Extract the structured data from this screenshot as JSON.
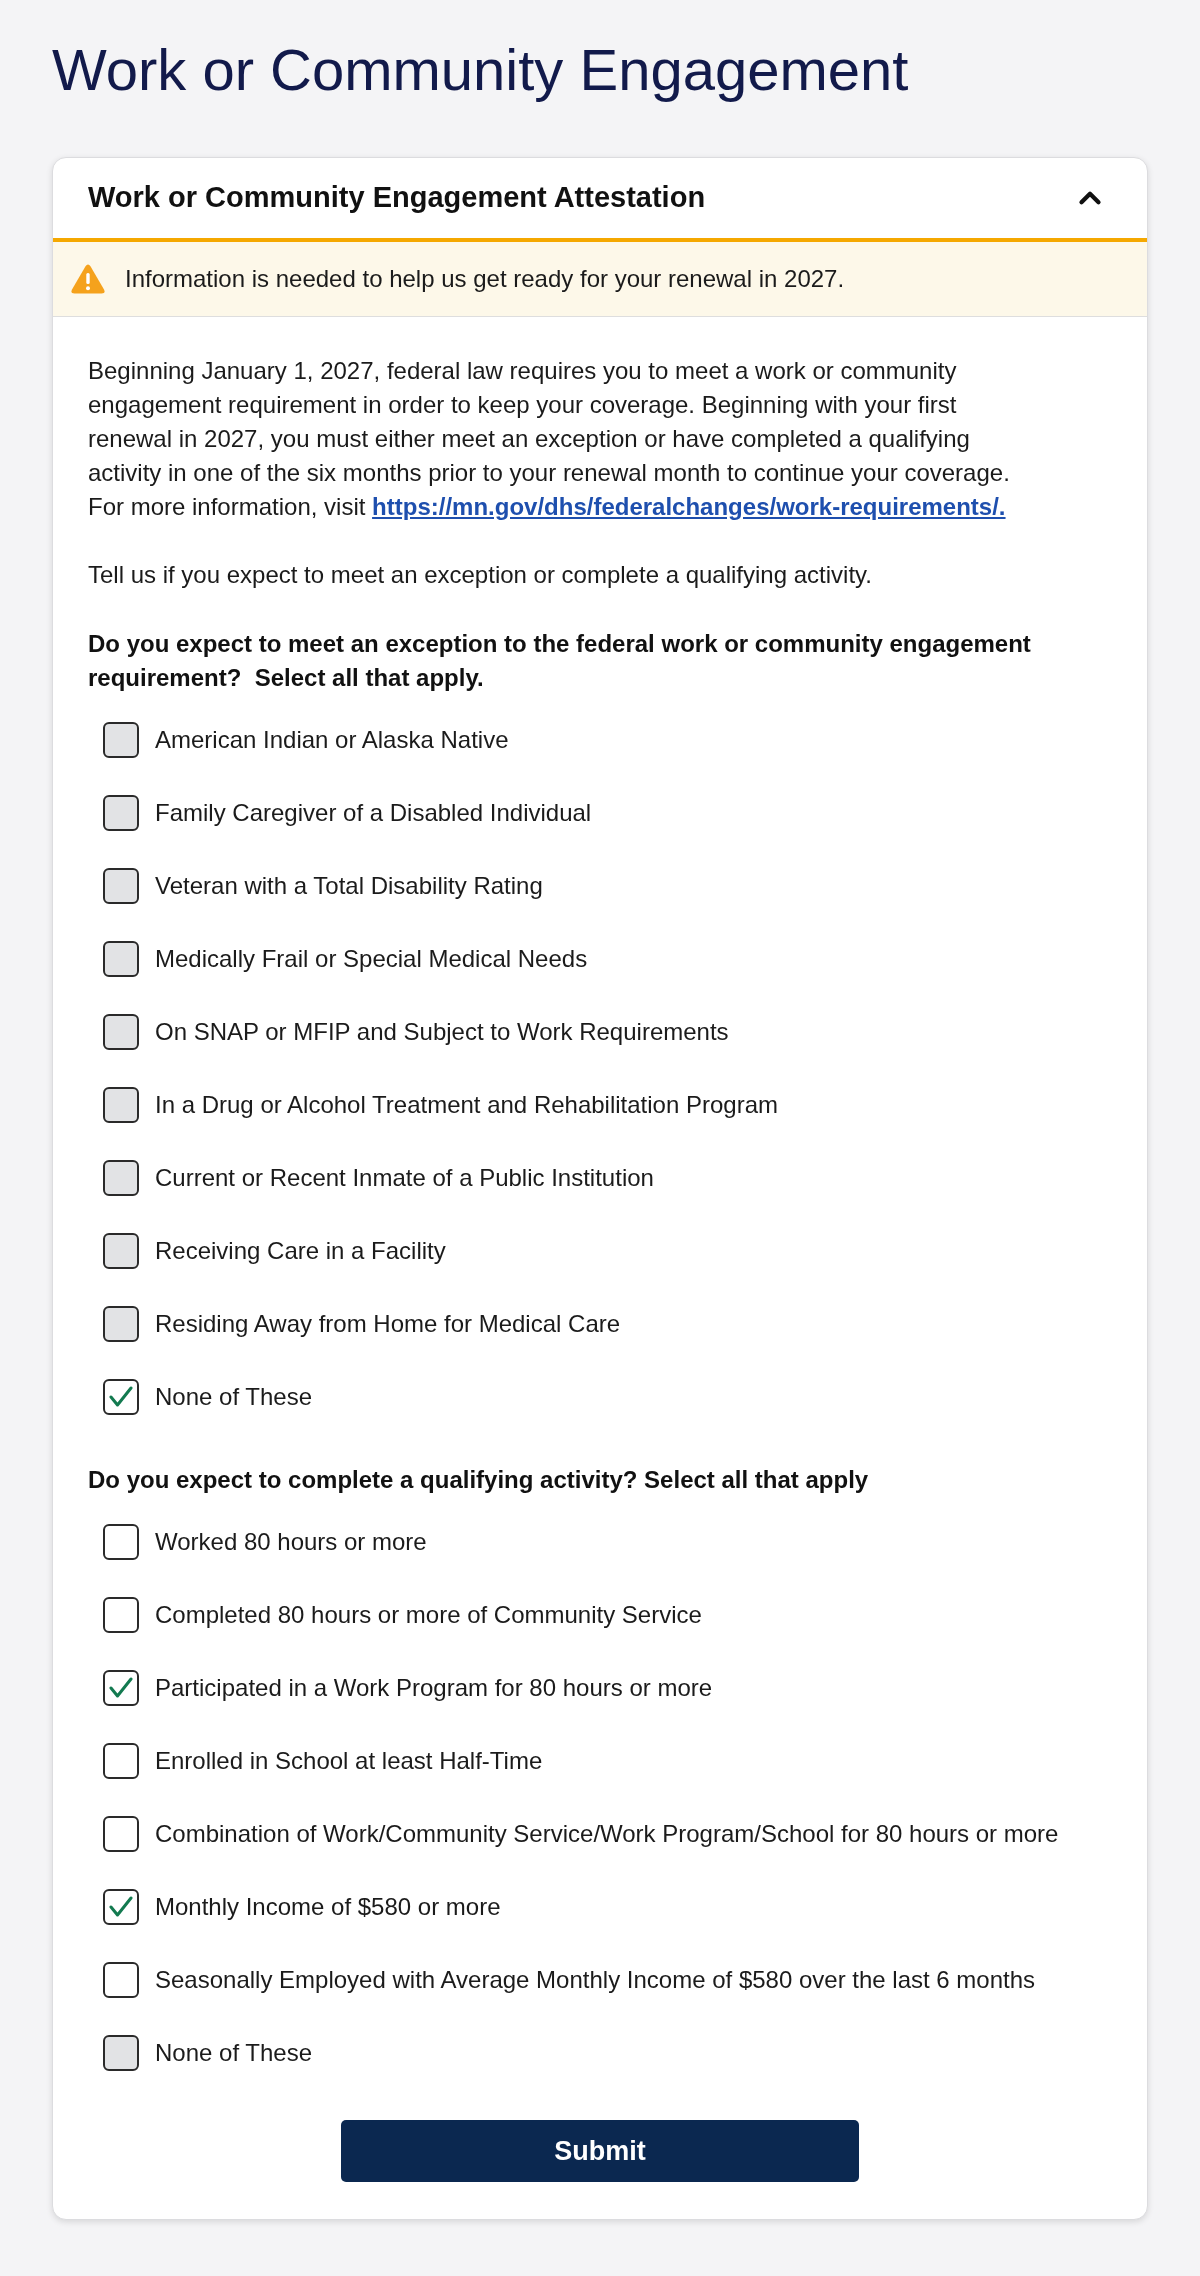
{
  "page": {
    "title": "Work or Community Engagement"
  },
  "accordion": {
    "title": "Work or Community Engagement Attestation",
    "expanded": true
  },
  "alert": {
    "text": "Information is needed to help us get ready for your renewal in 2027."
  },
  "intro": {
    "text": "Beginning January 1, 2027, federal law requires you to meet a work or community engagement requirement in order to keep your coverage. Beginning with your first renewal in 2027, you must either meet an exception or have completed a qualifying activity in one of the six months prior to your renewal month to continue your coverage. For more information, visit",
    "link": "https://mn.gov/dhs/federalchanges/work-requirements/."
  },
  "prompt": "Tell us if you expect to meet an exception or complete a qualifying activity.",
  "exceptions": {
    "question": "Do you expect to meet an exception to the federal work or community engagement requirement?  Select all that apply.",
    "options": [
      {
        "label": "American Indian or Alaska Native",
        "checked": false,
        "disabled": true
      },
      {
        "label": "Family Caregiver of a Disabled Individual",
        "checked": false,
        "disabled": true
      },
      {
        "label": "Veteran with a Total Disability Rating",
        "checked": false,
        "disabled": true
      },
      {
        "label": "Medically Frail or Special Medical Needs",
        "checked": false,
        "disabled": true
      },
      {
        "label": "On SNAP or MFIP and Subject to Work Requirements",
        "checked": false,
        "disabled": true
      },
      {
        "label": "In a Drug or Alcohol Treatment and Rehabilitation Program",
        "checked": false,
        "disabled": true
      },
      {
        "label": "Current or Recent Inmate of a Public Institution",
        "checked": false,
        "disabled": true
      },
      {
        "label": "Receiving Care in a Facility",
        "checked": false,
        "disabled": true
      },
      {
        "label": "Residing Away from Home for Medical Care",
        "checked": false,
        "disabled": true
      },
      {
        "label": "None of These",
        "checked": true,
        "disabled": false
      }
    ]
  },
  "activities": {
    "question": "Do you expect to complete a qualifying activity? Select all that apply",
    "options": [
      {
        "label": "Worked 80 hours or more",
        "checked": false,
        "disabled": false
      },
      {
        "label": "Completed 80 hours or more of Community Service",
        "checked": false,
        "disabled": false
      },
      {
        "label": "Participated in a Work Program for 80 hours or more",
        "checked": true,
        "disabled": false
      },
      {
        "label": "Enrolled in School at least Half-Time",
        "checked": false,
        "disabled": false
      },
      {
        "label": "Combination of Work/Community Service/Work Program/School for 80 hours or more",
        "checked": false,
        "disabled": false
      },
      {
        "label": "Monthly Income of $580 or more",
        "checked": true,
        "disabled": false
      },
      {
        "label": "Seasonally Employed with Average Monthly Income of $580 over the last 6 months",
        "checked": false,
        "disabled": false
      },
      {
        "label": "None of These",
        "checked": false,
        "disabled": true
      }
    ]
  },
  "submit": {
    "label": "Submit"
  }
}
